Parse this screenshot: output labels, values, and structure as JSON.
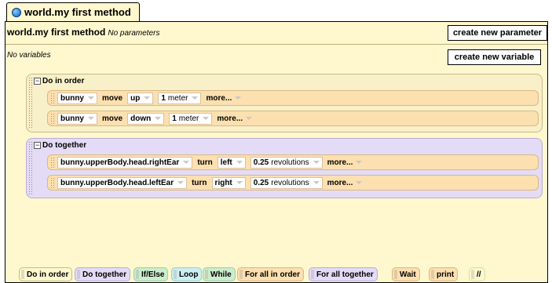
{
  "tab": {
    "title": "world.my first method"
  },
  "method": {
    "name": "world.my first method",
    "params_text": "No parameters",
    "create_param_label": "create new parameter"
  },
  "variables": {
    "text": "No variables",
    "create_var_label": "create new variable"
  },
  "do_in_order": {
    "label": "Do in order",
    "statements": [
      {
        "object": "bunny",
        "verb": "move",
        "direction": "up",
        "amount": "1",
        "unit": "meter",
        "more": "more..."
      },
      {
        "object": "bunny",
        "verb": "move",
        "direction": "down",
        "amount": "1",
        "unit": "meter",
        "more": "more..."
      }
    ]
  },
  "do_together": {
    "label": "Do together",
    "statements": [
      {
        "object": "bunny.upperBody.head.rightEar",
        "verb": "turn",
        "direction": "left",
        "amount": "0.25",
        "unit": "revolutions",
        "more": "more..."
      },
      {
        "object": "bunny.upperBody.head.leftEar",
        "verb": "turn",
        "direction": "right",
        "amount": "0.25",
        "unit": "revolutions",
        "more": "more..."
      }
    ]
  },
  "palette": [
    "Do in order",
    "Do together",
    "If/Else",
    "Loop",
    "While",
    "For all in order",
    "For all together",
    "Wait",
    "print",
    "//"
  ],
  "colors": {
    "editor_bg": "#fff8cf",
    "order_block": "#f8f0c8",
    "together_block": "#e4dcf6",
    "stmt": "#fce0b0"
  }
}
